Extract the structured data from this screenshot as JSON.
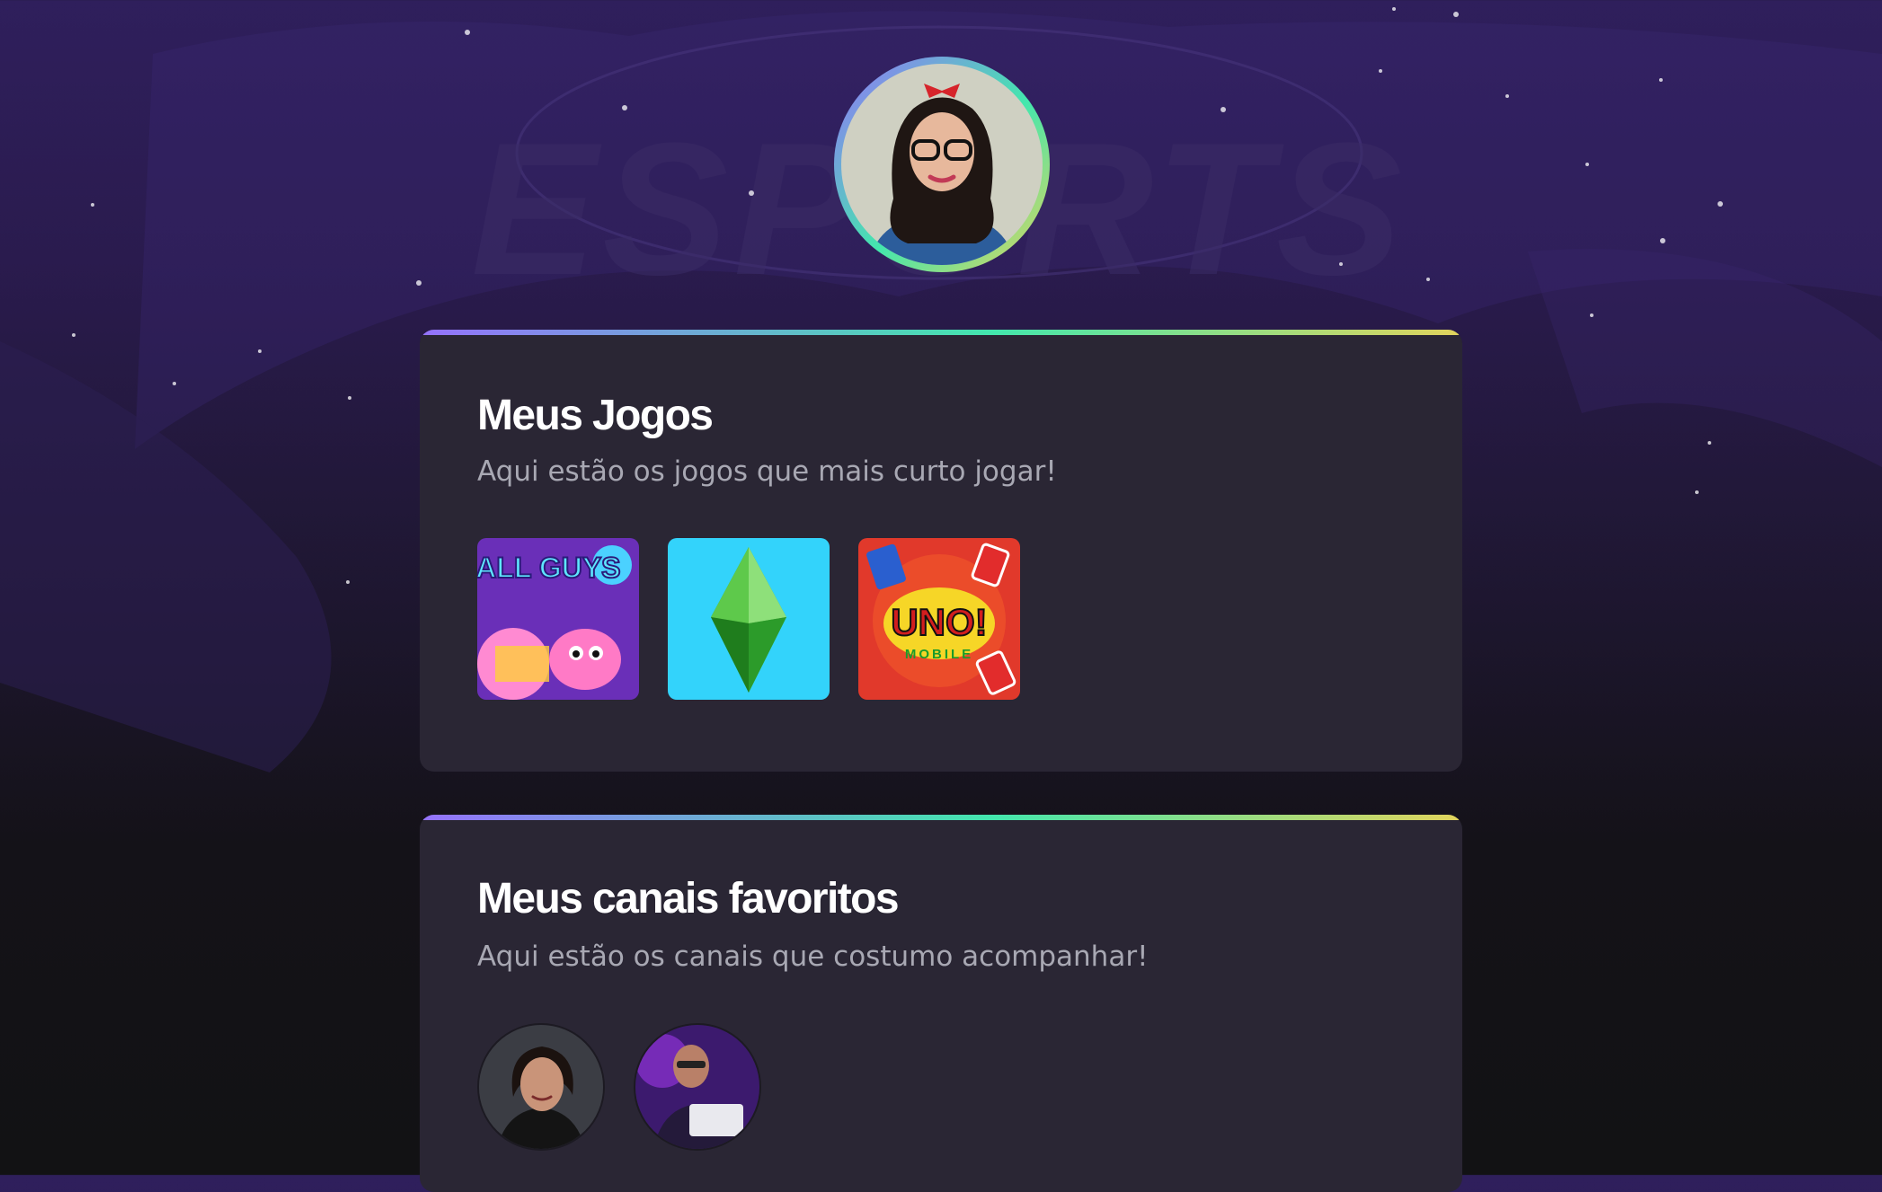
{
  "profile": {
    "avatar_alt": "profile-photo"
  },
  "background": {
    "watermark_text": "ESPORTS"
  },
  "games_section": {
    "title": "Meus Jogos",
    "subtitle": "Aqui estão os jogos que mais curto jogar!",
    "games": [
      {
        "name": "Fall Guys",
        "logo_text": "FALL GUYS",
        "icon": "fall-guys-cover"
      },
      {
        "name": "The Sims",
        "icon": "plumbob-diamond"
      },
      {
        "name": "UNO! Mobile",
        "logo_text": "UNO!",
        "logo_sub": "MOBILE",
        "icon": "uno-cover"
      }
    ]
  },
  "channels_section": {
    "title": "Meus canais favoritos",
    "subtitle": "Aqui estão os canais que costumo acompanhar!",
    "channels": [
      {
        "icon": "channel-avatar-1"
      },
      {
        "icon": "channel-avatar-2"
      }
    ]
  },
  "colors": {
    "gradient_start": "#9572fc",
    "gradient_mid": "#43e7ad",
    "gradient_end": "#e2d45c",
    "card_bg": "#2a2634",
    "subtitle_text": "#a8a8b3"
  }
}
